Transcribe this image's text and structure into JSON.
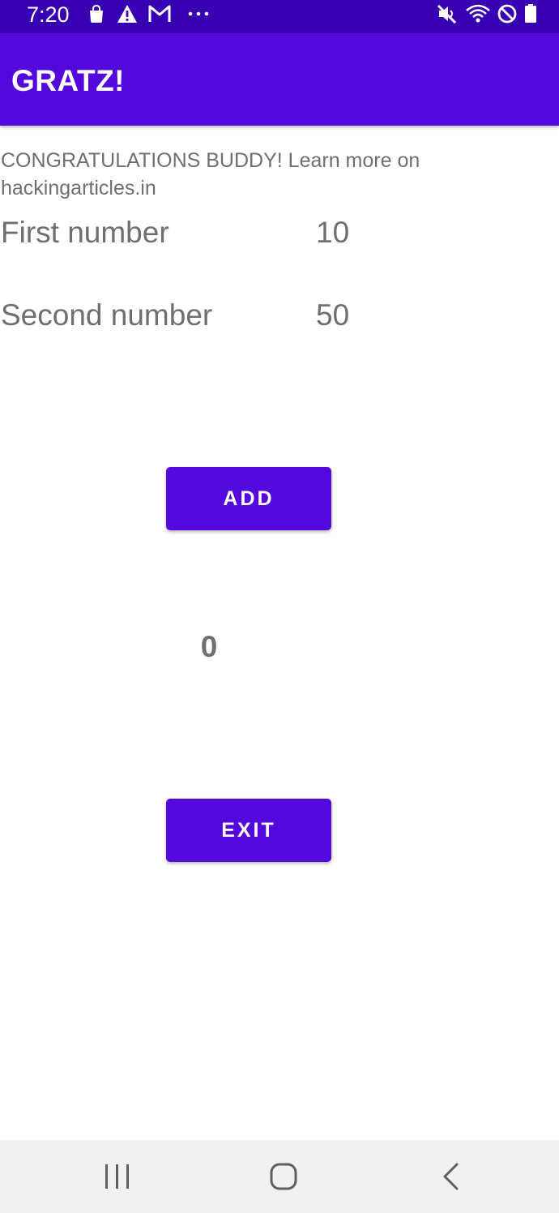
{
  "status_bar": {
    "time": "7:20",
    "left_icons": [
      "shopping-bag-icon",
      "warning-icon",
      "gmail-icon",
      "more-notifications-icon"
    ],
    "right_icons": [
      "mute-icon",
      "wifi-icon",
      "do-not-disturb-icon",
      "battery-icon"
    ]
  },
  "app_bar": {
    "title": "GRATZ!"
  },
  "main": {
    "message": "CONGRATULATIONS BUDDY! Learn more on hackingarticles.in",
    "first_number": {
      "label": "First number",
      "value": "10"
    },
    "second_number": {
      "label": "Second number",
      "value": "50"
    },
    "add_button": "ADD",
    "result": "0",
    "exit_button": "EXIT"
  },
  "nav_bar": {
    "buttons": [
      "recent-apps-icon",
      "home-icon",
      "back-icon"
    ]
  },
  "colors": {
    "status_bar": "#3700b3",
    "primary": "#5409dc",
    "text": "#6f6f6f",
    "nav_bar": "#f1f1f1"
  }
}
